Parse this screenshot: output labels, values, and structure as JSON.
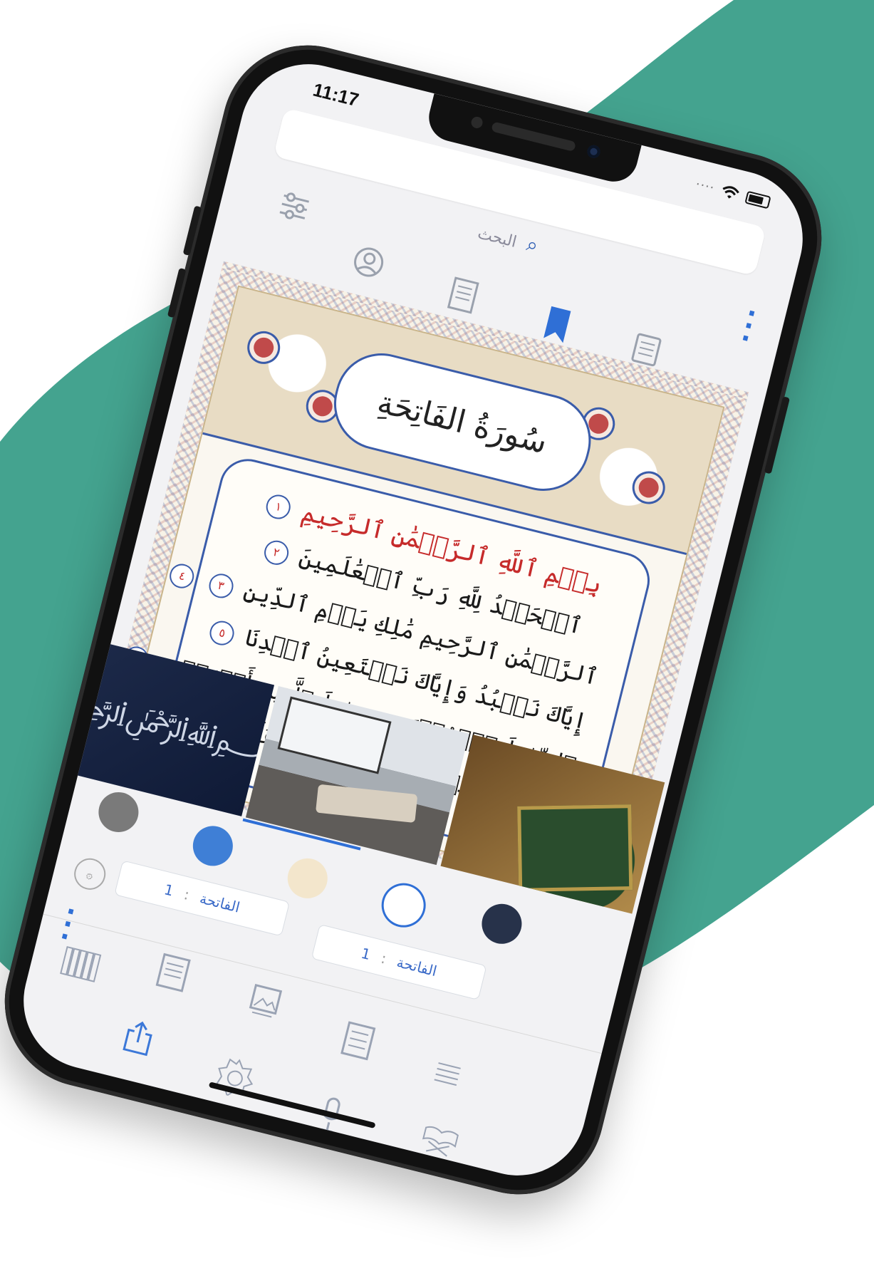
{
  "status": {
    "time": "11:17"
  },
  "search": {
    "label": "البحث"
  },
  "toolbar": {
    "icons": [
      "sliders-icon",
      "user-icon",
      "book-icon",
      "bookmark-icon",
      "list-icon",
      "more-vertical-icon"
    ]
  },
  "mushaf": {
    "surah_title": "سُورَةُ الفَاتِحَةِ",
    "basmala": "بِسۡمِ ٱللَّهِ ٱلرَّحۡمَٰنِ ٱلرَّحِيمِ",
    "lines": [
      "ٱلۡحَمۡدُ لِلَّهِ رَبِّ ٱلۡعَٰلَمِينَ",
      "ٱلرَّحۡمَٰنِ ٱلرَّحِيمِ مَٰلِكِ يَوۡمِ ٱلدِّينِ",
      "إِيَّاكَ نَعۡبُدُ وَإِيَّاكَ نَسۡتَعِينُ ٱهۡدِنَا",
      "ٱلصِّرَٰطَ ٱلۡمُسۡتَقِيمَ صِرَٰطَ ٱلَّذِينَ أَنۡعَمۡتَ",
      "عَلَيۡهِمۡ غَيۡرِ ٱلۡمَغۡضُوبِ عَلَيۡهِمۡ"
    ],
    "ayah_numbers": [
      "١",
      "٢",
      "٣",
      "٤",
      "٥",
      "٦"
    ]
  },
  "backgrounds": {
    "thumbs": [
      "navy-calligraphy",
      "desk-quran",
      "green-quran"
    ],
    "selected_index": 1
  },
  "swatches": {
    "colors": [
      "#7a7a7a",
      "#3f7fd6",
      "#f3e6cc",
      "#ffffff",
      "#27324a"
    ],
    "selected_index": 3
  },
  "range": {
    "from": {
      "surah": "الفاتحة",
      "separator": ":",
      "ayah": "1"
    },
    "to": {
      "surah": "الفاتحة",
      "separator": ":",
      "ayah": "1"
    }
  },
  "bottom_bar": {
    "icons": [
      "library-icon",
      "page-icon",
      "image-icon",
      "text-page-icon",
      "share-icon",
      "emblem-icon",
      "microphone-icon",
      "lines-icon",
      "quran-stand-icon"
    ]
  },
  "colors": {
    "accent": "#2f6fd6",
    "teal": "#44a38f",
    "frame": "#111111"
  }
}
